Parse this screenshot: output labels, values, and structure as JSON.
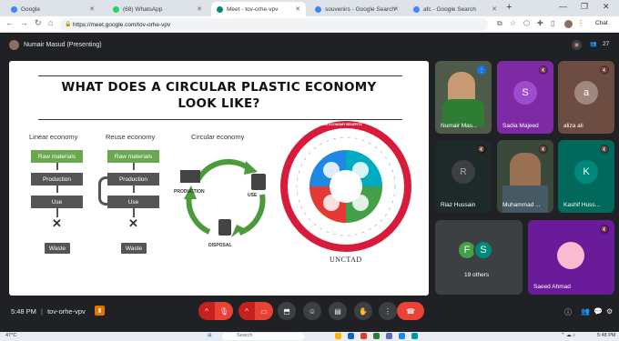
{
  "browser": {
    "tabs": [
      {
        "label": "Google",
        "fav_color": "#4285f4",
        "active": false
      },
      {
        "label": "(68) WhatsApp",
        "fav_color": "#25d366",
        "active": false
      },
      {
        "label": "Meet - tov-orhe-vpv",
        "fav_color": "#00897b",
        "active": true
      },
      {
        "label": "souvenirs - Google Search",
        "fav_color": "#4285f4",
        "active": false
      },
      {
        "label": "afc - Google Search",
        "fav_color": "#4285f4",
        "active": false
      }
    ],
    "url": "https://meet.google.com/tov-orhe-vpv",
    "chat_label": "Chat"
  },
  "meet": {
    "presenter": "Numair Masud (Presenting)",
    "participant_count": "27",
    "meeting_code": "tov-orhe-vpv",
    "time": "5:48 PM"
  },
  "slide": {
    "title_line1": "WHAT DOES A CIRCULAR PLASTIC ECONOMY",
    "title_line2": "LOOK LIKE?",
    "linear": {
      "heading": "Linear economy",
      "raw": "Raw materials",
      "production": "Production",
      "use": "Use",
      "waste": "Waste"
    },
    "reuse": {
      "heading": "Reuse economy",
      "raw": "Raw materials",
      "production": "Production",
      "use": "Use",
      "waste": "Waste"
    },
    "circular": {
      "heading": "Circular economy",
      "production": "PRODUCTION",
      "use": "USE",
      "disposal": "DISPOSAL"
    },
    "wheel_caption": "CIRCULAR ECONOMY BENEFITS",
    "unctad": "UNCTAD"
  },
  "tiles": [
    {
      "name": "Numair Mas...",
      "type": "video"
    },
    {
      "name": "Sadia Majeed",
      "initial": "S",
      "color": "#7b1fa2"
    },
    {
      "name": "aliza ali",
      "initial": "a",
      "color": "#8d6e63"
    },
    {
      "name": "Riaz Hussain",
      "initial": "R",
      "color": "#5f6368"
    },
    {
      "name": "Muhammad ...",
      "type": "video"
    },
    {
      "name": "Kashif Huss...",
      "initial": "K",
      "color": "#00897b"
    },
    {
      "name": "19 others",
      "initial_a": "F",
      "initial_b": "S"
    },
    {
      "name": "Saeed Ahmad"
    }
  ],
  "taskbar": {
    "weather": "47°C",
    "search_placeholder": "Search",
    "clock": "5:48 PM",
    "date": "3/6/2023"
  }
}
